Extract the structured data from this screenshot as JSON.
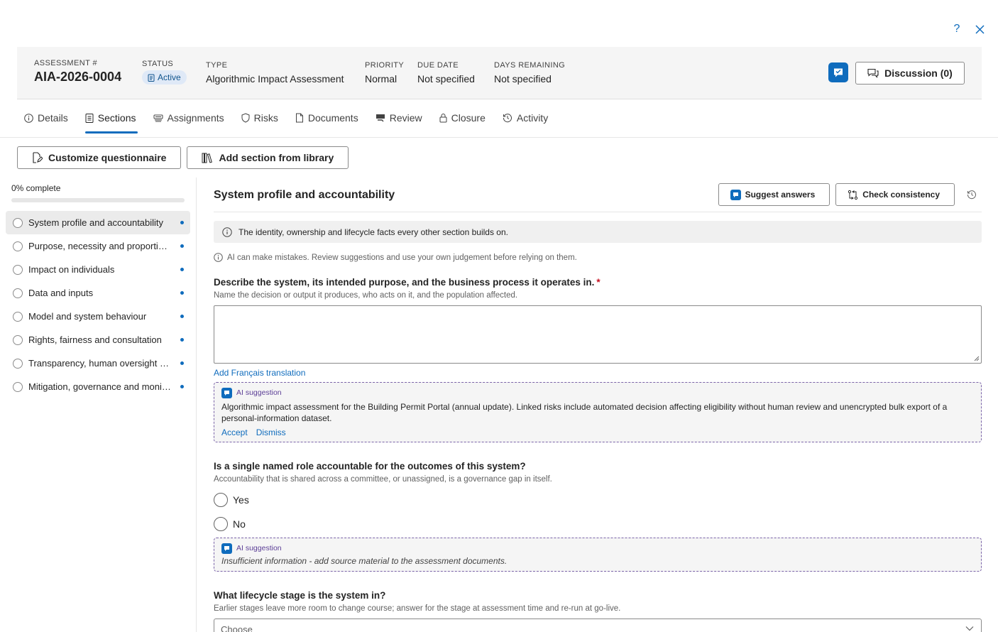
{
  "window": {
    "help_glyph": "?",
    "close_glyph": "✕"
  },
  "header": {
    "assessment_label": "ASSESSMENT #",
    "assessment_value": "AIA-2026-0004",
    "status_label": "STATUS",
    "status_value": "Active",
    "type_label": "TYPE",
    "type_value": "Algorithmic Impact Assessment",
    "priority_label": "PRIORITY",
    "priority_value": "Normal",
    "due_label": "DUE DATE",
    "due_value": "Not specified",
    "days_label": "DAYS REMAINING",
    "days_value": "Not specified",
    "discussion_label": "Discussion (0)"
  },
  "tabs": [
    {
      "label": "Details",
      "icon": "info-icon"
    },
    {
      "label": "Sections",
      "icon": "clipboard-icon"
    },
    {
      "label": "Assignments",
      "icon": "people-icon"
    },
    {
      "label": "Risks",
      "icon": "shield-icon"
    },
    {
      "label": "Documents",
      "icon": "document-icon"
    },
    {
      "label": "Review",
      "icon": "review-icon"
    },
    {
      "label": "Closure",
      "icon": "lock-icon"
    },
    {
      "label": "Activity",
      "icon": "history-icon"
    }
  ],
  "active_tab": "Sections",
  "toolbar": {
    "customize_label": "Customize questionnaire",
    "library_label": "Add section from library"
  },
  "sidebar": {
    "progress_label": "0% complete",
    "progress_fraction": 0,
    "items": [
      {
        "label": "System profile and accountability"
      },
      {
        "label": "Purpose, necessity and proportionality"
      },
      {
        "label": "Impact on individuals"
      },
      {
        "label": "Data and inputs"
      },
      {
        "label": "Model and system behaviour"
      },
      {
        "label": "Rights, fairness and consultation"
      },
      {
        "label": "Transparency, human oversight and explainability"
      },
      {
        "label": "Mitigation, governance and monitoring"
      }
    ]
  },
  "section": {
    "title": "System profile and accountability",
    "suggest_label": "Suggest answers",
    "consistency_label": "Check consistency",
    "info_text": "The identity, ownership and lifecycle facts every other section builds on.",
    "disclaimer": "AI can make mistakes. Review suggestions and use your own judgement before relying on them."
  },
  "q1": {
    "title": "Describe the system, its intended purpose, and the business process it operates in.",
    "required_mark": "*",
    "help": "Name the decision or output it produces, who acts on it, and the population affected.",
    "value": "",
    "translation_link": "Add Français translation",
    "ai_label": "AI suggestion",
    "ai_text": "Algorithmic impact assessment for the Building Permit Portal (annual update). Linked risks include automated decision affecting eligibility without human review and unencrypted bulk export of a personal-information dataset.",
    "accept_label": "Accept",
    "dismiss_label": "Dismiss"
  },
  "q2": {
    "title": "Is a single named role accountable for the outcomes of this system?",
    "help": "Accountability that is shared across a committee, or unassigned, is a governance gap in itself.",
    "options": [
      "Yes",
      "No"
    ],
    "ai_label": "AI suggestion",
    "ai_text": "Insufficient information - add source material to the assessment documents."
  },
  "q3": {
    "title": "What lifecycle stage is the system in?",
    "help": "Earlier stages leave more room to change course; answer for the stage at assessment time and re-run at go-live.",
    "placeholder": "Choose"
  },
  "colors": {
    "accent": "#0f6cbd",
    "ai_border": "#7a63a8",
    "required": "#c50f1f"
  }
}
